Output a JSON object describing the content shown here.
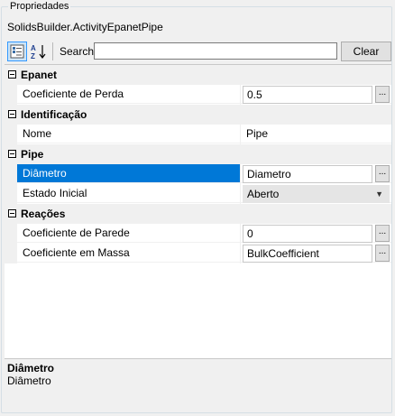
{
  "group_title": "Propriedades",
  "object_name": "SolidsBuilder.ActivityEpanetPipe",
  "toolbar": {
    "categorized_icon": "categorized-view-icon",
    "alphabetical_icon": "alphabetical-sort-icon",
    "search_label": "Search:",
    "search_value": "",
    "clear_label": "Clear"
  },
  "categories": [
    {
      "label": "Epanet",
      "properties": [
        {
          "name": "Coeficiente de Perda",
          "value": "0.5",
          "editor": "ellipsis"
        }
      ]
    },
    {
      "label": "Identificação",
      "properties": [
        {
          "name": "Nome",
          "value": "Pipe",
          "editor": "text"
        }
      ]
    },
    {
      "label": "Pipe",
      "properties": [
        {
          "name": "Diâmetro",
          "value": "Diametro",
          "editor": "ellipsis",
          "selected": true
        },
        {
          "name": "Estado Inicial",
          "value": "Aberto",
          "editor": "dropdown"
        }
      ]
    },
    {
      "label": "Reações",
      "properties": [
        {
          "name": "Coeficiente de Parede",
          "value": "0",
          "editor": "ellipsis"
        },
        {
          "name": "Coeficiente em Massa",
          "value": "BulkCoefficient",
          "editor": "ellipsis"
        }
      ]
    }
  ],
  "ellipsis_label": "...",
  "description": {
    "title": "Diâmetro",
    "text": "Diâmetro"
  },
  "colors": {
    "selection": "#0078d7",
    "gutter": "#f0f0f0",
    "pressed_button": "#cce4f7"
  }
}
